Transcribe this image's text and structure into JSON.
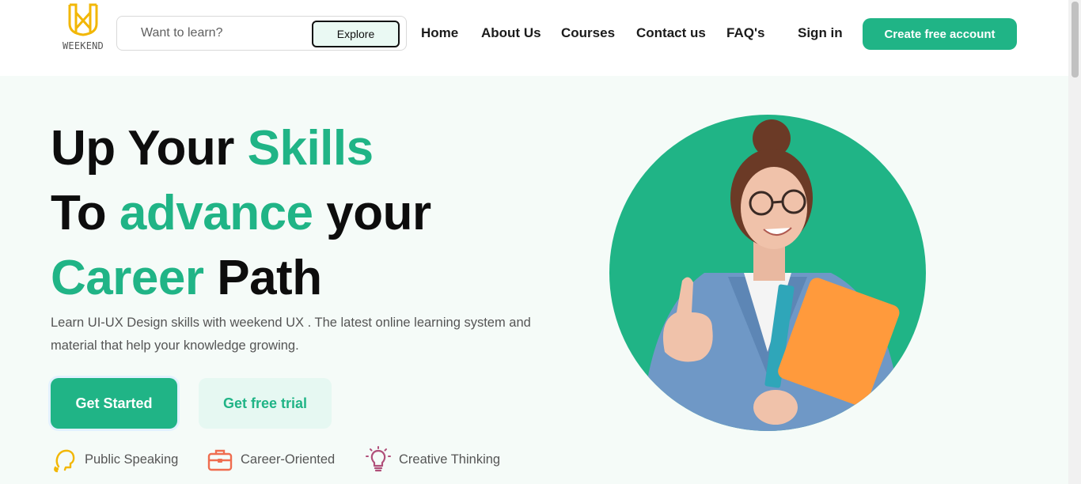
{
  "brand": {
    "logo_text": "WEEKEND",
    "accent_color": "#20b486",
    "logo_color": "#f2b705"
  },
  "search": {
    "placeholder": "Want to learn?",
    "button_label": "Explore"
  },
  "nav": {
    "links": [
      {
        "label": "Home"
      },
      {
        "label": "About Us"
      },
      {
        "label": "Courses"
      },
      {
        "label": "Contact us"
      },
      {
        "label": "FAQ's"
      }
    ],
    "sign_in": "Sign in",
    "cta": "Create free account"
  },
  "hero": {
    "line1": {
      "a": "Up Your ",
      "b": "Skills"
    },
    "line2": {
      "a": "To ",
      "b": "advance",
      "c": " your"
    },
    "line3": {
      "a": "Career",
      "b": " Path"
    },
    "description": "Learn UI-UX Design skills with weekend UX . The latest online learning system and material that help your knowledge growing.",
    "primary_button": "Get Started",
    "secondary_button": "Get free trial",
    "image_subject": "student-holding-books-thumbs-up"
  },
  "features": [
    {
      "label": "Public Speaking",
      "icon": "head-speaking-icon"
    },
    {
      "label": "Career-Oriented",
      "icon": "briefcase-icon"
    },
    {
      "label": "Creative Thinking",
      "icon": "lightbulb-icon"
    }
  ]
}
